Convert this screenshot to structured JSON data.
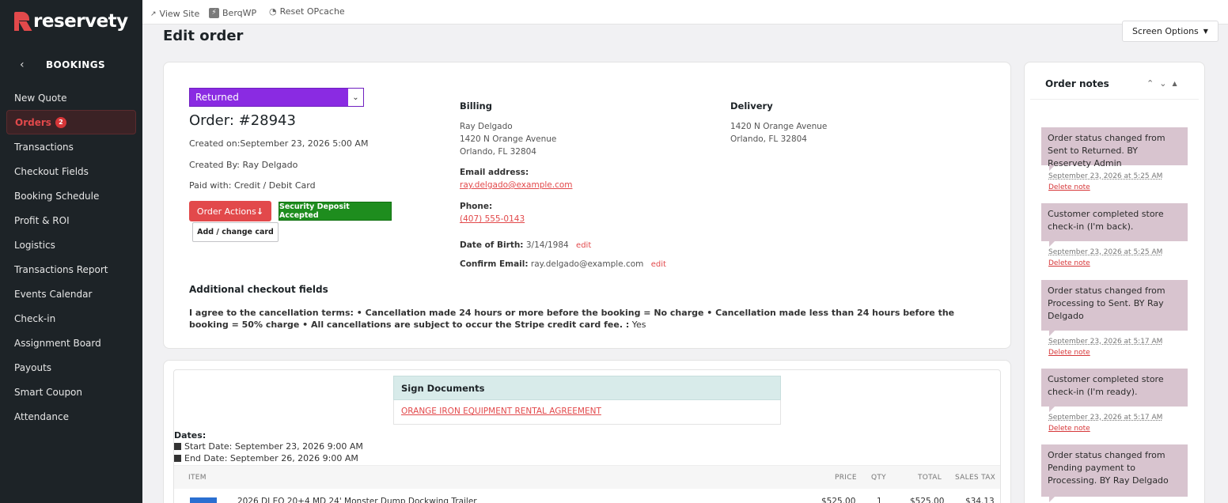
{
  "brand": {
    "name": "reservety",
    "color": "#e2494b"
  },
  "sidebar": {
    "section": "BOOKINGS",
    "items": [
      {
        "label": "New Quote"
      },
      {
        "label": "Orders",
        "badge": "2",
        "active": true
      },
      {
        "label": "Transactions"
      },
      {
        "label": "Checkout Fields"
      },
      {
        "label": "Booking Schedule"
      },
      {
        "label": "Profit & ROI"
      },
      {
        "label": "Logistics"
      },
      {
        "label": "Transactions Report"
      },
      {
        "label": "Events Calendar"
      },
      {
        "label": "Check-in"
      },
      {
        "label": "Assignment Board"
      },
      {
        "label": "Payouts"
      },
      {
        "label": "Smart Coupon"
      },
      {
        "label": "Attendance"
      }
    ]
  },
  "topbar": {
    "view_site": "View Site",
    "berqwp": "BerqWP",
    "reset_opcache": "Reset OPcache",
    "screen_options": "Screen Options"
  },
  "page": {
    "title": "Edit order"
  },
  "order": {
    "status": "Returned",
    "status_color": "#8a2be2",
    "number": "Order: #28943",
    "created_on": "Created on:September 23, 2026 5:00 AM",
    "created_by": "Created By: Ray Delgado",
    "paid_with": "Paid with: Credit / Debit Card",
    "actions_label": "Order Actions",
    "deposit_label": "Security Deposit Accepted",
    "card_label": "Add / change card"
  },
  "billing": {
    "heading": "Billing",
    "name": "Ray Delgado",
    "street": "1420 N Orange Avenue",
    "city": "Orlando, FL 32804",
    "email_label": "Email address:",
    "email": "ray.delgado@example.com",
    "phone_label": "Phone:",
    "phone": "(407) 555-0143",
    "dob_label": "Date of Birth:",
    "dob": "3/14/1984",
    "confirm_label": "Confirm Email:",
    "confirm_email": "ray.delgado@example.com",
    "edit": "edit"
  },
  "delivery": {
    "heading": "Delivery",
    "street": "1420 N Orange Avenue",
    "city": "Orlando, FL 32804"
  },
  "additional": {
    "heading": "Additional checkout fields",
    "terms": "I agree to the cancellation terms: • Cancellation made 24 hours or more before the booking = No charge • Cancellation made less than 24 hours before the booking = 50% charge • All cancellations are subject to occur the Stripe credit card fee. :",
    "answer": "Yes"
  },
  "documents": {
    "heading": "Sign Documents",
    "link": "ORANGE IRON EQUIPMENT RENTAL AGREEMENT"
  },
  "dates": {
    "heading": "Dates:",
    "start": "Start Date: September 23, 2026 9:00 AM",
    "end": "End Date: September 26, 2026 9:00 AM"
  },
  "table": {
    "columns": [
      "ITEM",
      "PRICE",
      "QTY",
      "TOTAL",
      "SALES TAX"
    ],
    "partial_row": {
      "item": "2026 DJ EQ 20+4 MD 24' Monster Dump Dockwing Trailer",
      "price": "$525.00",
      "qty": "1",
      "total": "$525.00",
      "tax": "$34.13"
    }
  },
  "notes": {
    "title": "Order notes",
    "delete_label": "Delete note",
    "items": [
      {
        "text": "Order status changed from Sent to Returned. BY Reservety Admin",
        "date": "September 23, 2026 at 5:25 AM"
      },
      {
        "text": "Customer completed store check-in (I'm back).",
        "date": "September 23, 2026 at 5:25 AM"
      },
      {
        "text": "Order status changed from Processing to Sent. BY Ray Delgado",
        "date": "September 23, 2026 at 5:17 AM"
      },
      {
        "text": "Customer completed store check-in (I'm ready).",
        "date": "September 23, 2026 at 5:17 AM"
      },
      {
        "text": "Order status changed from Pending payment to Processing. BY Ray Delgado",
        "date": ""
      }
    ]
  }
}
